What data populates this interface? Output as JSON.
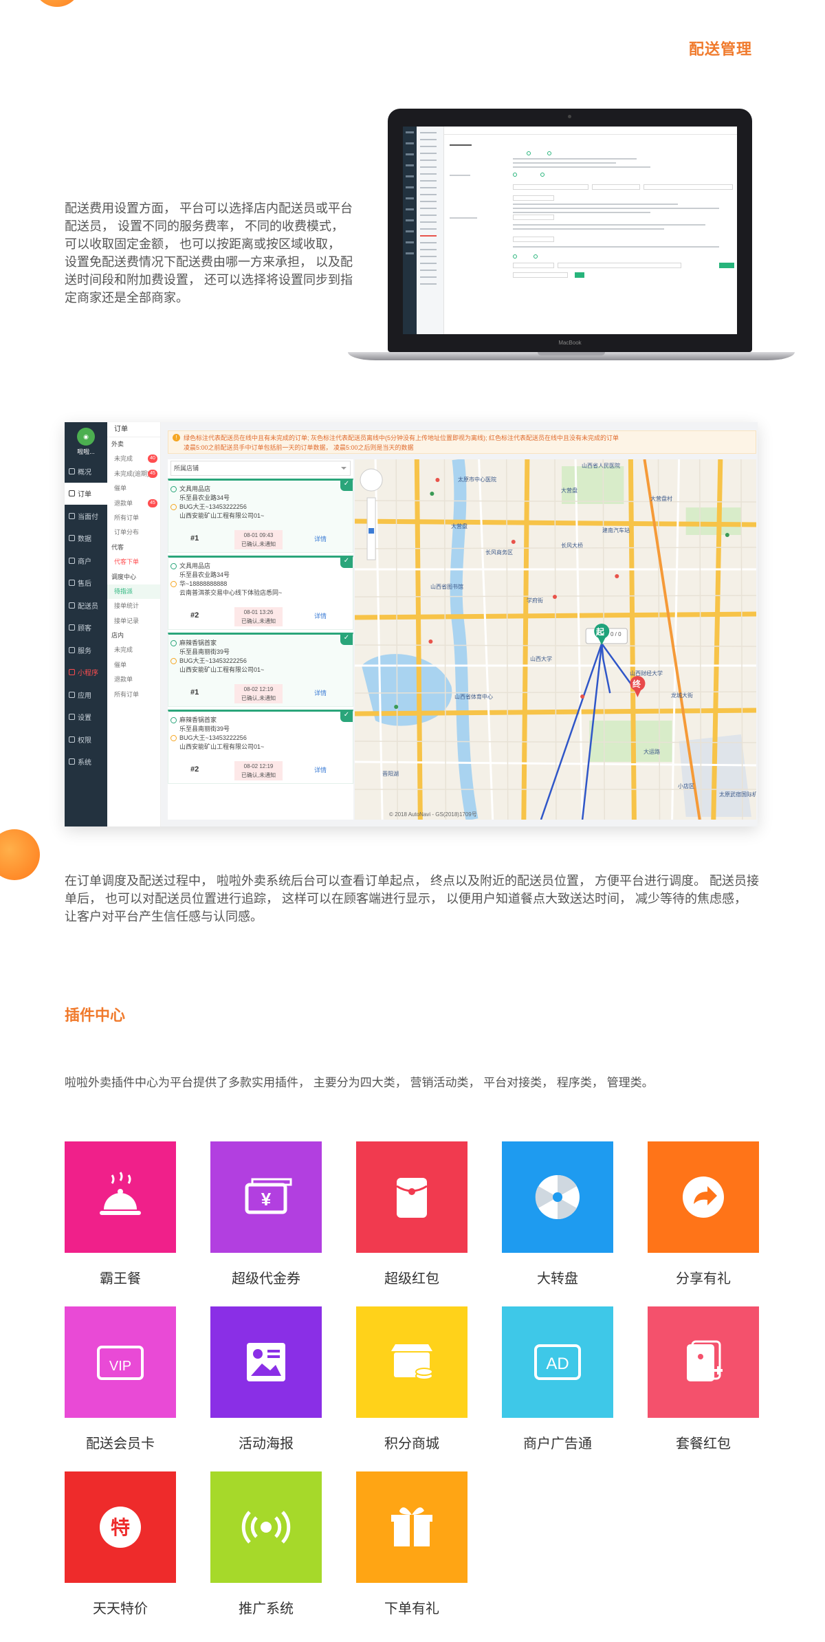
{
  "header": {
    "section_title": "配送管理"
  },
  "para_fee": "配送费用设置方面， 平台可以选择店内配送员或平台配送员， 设置不同的服务费率， 不同的收费模式， 可以收取固定金额， 也可以按距离或按区域收取， 设置免配送费情况下配送费由哪一方来承担， 以及配送时间段和附加费设置， 还可以选择将设置同步到指定商家还是全部商家。",
  "laptop": {
    "brand": "MacBook"
  },
  "dispatch": {
    "logo_text": "啦啦...",
    "side": [
      {
        "label": "概况",
        "active": false,
        "red": false
      },
      {
        "label": "订单",
        "active": true,
        "red": false
      },
      {
        "label": "当面付",
        "active": false,
        "red": false
      },
      {
        "label": "数据",
        "active": false,
        "red": false
      },
      {
        "label": "商户",
        "active": false,
        "red": false
      },
      {
        "label": "售后",
        "active": false,
        "red": false
      },
      {
        "label": "配送员",
        "active": false,
        "red": false
      },
      {
        "label": "顾客",
        "active": false,
        "red": false
      },
      {
        "label": "服务",
        "active": false,
        "red": false
      },
      {
        "label": "小程序",
        "active": false,
        "red": true
      },
      {
        "label": "应用",
        "active": false,
        "red": false
      },
      {
        "label": "设置",
        "active": false,
        "red": false
      },
      {
        "label": "权限",
        "active": false,
        "red": false
      },
      {
        "label": "系统",
        "active": false,
        "red": false
      }
    ],
    "sub_head": "订单",
    "sub": [
      {
        "label": "外卖",
        "type": "grp"
      },
      {
        "label": "未完成",
        "type": "item",
        "badge": "40"
      },
      {
        "label": "未完成(逾期)",
        "type": "item",
        "badge": "45"
      },
      {
        "label": "催单",
        "type": "item",
        "badge": ""
      },
      {
        "label": "退款单",
        "type": "item",
        "badge": "45"
      },
      {
        "label": "所有订单",
        "type": "item",
        "badge": ""
      },
      {
        "label": "订单分布",
        "type": "item",
        "badge": ""
      },
      {
        "label": "代客",
        "type": "grp"
      },
      {
        "label": "代客下单",
        "type": "red",
        "badge": ""
      },
      {
        "label": "调度中心",
        "type": "grp"
      },
      {
        "label": "待指派",
        "type": "sel",
        "badge": ""
      },
      {
        "label": "接单统计",
        "type": "item",
        "badge": ""
      },
      {
        "label": "接单记录",
        "type": "item",
        "badge": ""
      },
      {
        "label": "店内",
        "type": "grp"
      },
      {
        "label": "未完成",
        "type": "item",
        "badge": ""
      },
      {
        "label": "催单",
        "type": "item",
        "badge": ""
      },
      {
        "label": "退款单",
        "type": "item",
        "badge": ""
      },
      {
        "label": "所有订单",
        "type": "item",
        "badge": ""
      }
    ],
    "notice_line1": "绿色标注代表配送员在线中且有未完成的订单; 灰色标注代表配送员离线中(5分钟没有上传地址位置即视为离线); 红色标注代表配送员在线中且没有未完成的订单",
    "notice_line2": "凌晨5:00之前配送员手中订单包括前一天的订单数据， 凌晨5:00之后则是当天的数据",
    "search_value": "所属店铺",
    "orders": [
      {
        "store": "文具用品店",
        "store_addr": "乐至县农业路34号",
        "customer": "BUG大王~13453222256",
        "customer_addr": "山西安能矿山工程有限公司01~",
        "num": "#1",
        "time": "08-01 09:43",
        "status": "已确认,未通知",
        "detail": "详情"
      },
      {
        "store": "文具用品店",
        "store_addr": "乐至县农业路34号",
        "customer": "华~18888888888",
        "customer_addr": "云南普洱茶交易中心线下体验店悉同~",
        "num": "#2",
        "time": "08-01 13:26",
        "status": "已确认,未通知",
        "detail": "详情"
      },
      {
        "store": "麻辣香锅首家",
        "store_addr": "乐至县南丽街39号",
        "customer": "BUG大王~13453222256",
        "customer_addr": "山西安能矿山工程有限公司01~",
        "num": "#1",
        "time": "08-02 12:19",
        "status": "已确认,未通知",
        "detail": "详情"
      },
      {
        "store": "麻辣香锅首家",
        "store_addr": "乐至县南丽街39号",
        "customer": "BUG大王~13453222256",
        "customer_addr": "山西安能矿山工程有限公司01~",
        "num": "#2",
        "time": "08-02 12:19",
        "status": "已确认,未通知",
        "detail": "详情"
      }
    ],
    "map": {
      "labels": [
        {
          "text": "山西省人民医院"
        },
        {
          "text": "太原市中心医院"
        },
        {
          "text": "大营盘"
        },
        {
          "text": "大营盘村"
        },
        {
          "text": "大营盘"
        },
        {
          "text": "建南汽车站"
        },
        {
          "text": "长风商务区"
        },
        {
          "text": "山西省图书馆"
        },
        {
          "text": "长风大桥"
        },
        {
          "text": "学府街"
        },
        {
          "text": "山西大学"
        },
        {
          "text": "山西财经大学"
        },
        {
          "text": "龙城大街"
        },
        {
          "text": "晋阳湖"
        },
        {
          "text": "大运路"
        },
        {
          "text": "山西省体育中心"
        },
        {
          "text": "小店区"
        },
        {
          "text": "太原武宿国际机场"
        }
      ],
      "start_label": "起",
      "end_label": "终",
      "rider_count": "0 / 0",
      "copyright": "© 2018 AutoNavi - GS(2018)1709号"
    }
  },
  "para_dispatch": "在订单调度及配送过程中， 啦啦外卖系统后台可以查看订单起点， 终点以及附近的配送员位置， 方便平台进行调度。 配送员接单后， 也可以对配送员位置进行追踪， 这样可以在顾客端进行显示， 以便用户知道餐点大致送达时间， 减少等待的焦虑感， 让客户对平台产生信任感与认同感。",
  "plugin": {
    "title": "插件中心",
    "desc": "啦啦外卖插件中心为平台提供了多款实用插件， 主要分为四大类， 营销活动类， 平台对接类， 程序类， 管理类。",
    "items": [
      {
        "name": "霸王餐",
        "color": "#f0208a",
        "icon": "dining-cloche-icon"
      },
      {
        "name": "超级代金券",
        "color": "#b23fe0",
        "icon": "coupon-icon"
      },
      {
        "name": "超级红包",
        "color": "#f13a4f",
        "icon": "red-envelope-icon"
      },
      {
        "name": "大转盘",
        "color": "#1e9bf0",
        "icon": "lucky-wheel-icon"
      },
      {
        "name": "分享有礼",
        "color": "#ff7418",
        "icon": "share-arrow-icon"
      },
      {
        "name": "配送会员卡",
        "color": "#e94ad6",
        "icon": "vip-card-icon"
      },
      {
        "name": "活动海报",
        "color": "#8a2fe6",
        "icon": "poster-icon"
      },
      {
        "name": "积分商城",
        "color": "#ffd21a",
        "icon": "points-store-icon"
      },
      {
        "name": "商户广告通",
        "color": "#3ec8e8",
        "icon": "ad-icon"
      },
      {
        "name": "套餐红包",
        "color": "#f4516c",
        "icon": "package-red-envelope-icon"
      },
      {
        "name": "天天特价",
        "color": "#ee2b2b",
        "icon": "special-price-icon"
      },
      {
        "name": "推广系统",
        "color": "#a6d92a",
        "icon": "broadcast-icon"
      },
      {
        "name": "下单有礼",
        "color": "#ffa514",
        "icon": "gift-icon"
      }
    ]
  }
}
